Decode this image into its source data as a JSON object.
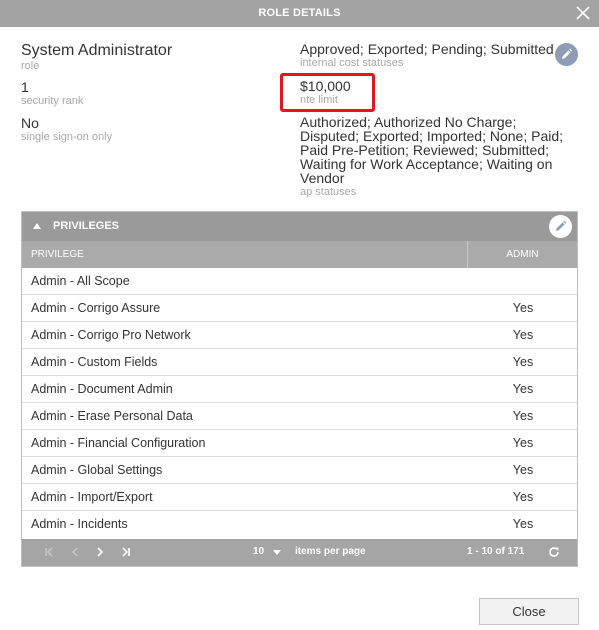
{
  "dialog": {
    "title": "ROLE DETAILS",
    "close_label": "Close"
  },
  "details": {
    "role": {
      "value": "System Administrator",
      "label": "role"
    },
    "security_rank": {
      "value": "1",
      "label": "security rank"
    },
    "sso": {
      "value": "No",
      "label": "single sign-on only"
    },
    "internal_cost_statuses": {
      "value": "Approved; Exported; Pending; Submitted",
      "label": "internal cost statuses"
    },
    "nte_limit": {
      "value": "$10,000",
      "label": "nte limit"
    },
    "ap_statuses": {
      "lines": [
        "Authorized; Authorized No Charge;",
        "Disputed; Exported; Imported; None; Paid;",
        "Paid Pre-Petition; Reviewed; Submitted;",
        "Waiting for Work Acceptance; Waiting on",
        "Vendor"
      ],
      "label": "ap statuses"
    }
  },
  "privileges": {
    "title": "PRIVILEGES",
    "columns": {
      "privilege": "PRIVILEGE",
      "admin": "ADMIN"
    },
    "rows": [
      {
        "privilege": "Admin - All Scope",
        "admin": ""
      },
      {
        "privilege": "Admin - Corrigo Assure",
        "admin": "Yes"
      },
      {
        "privilege": "Admin - Corrigo Pro Network",
        "admin": "Yes"
      },
      {
        "privilege": "Admin - Custom Fields",
        "admin": "Yes"
      },
      {
        "privilege": "Admin - Document Admin",
        "admin": "Yes"
      },
      {
        "privilege": "Admin - Erase Personal Data",
        "admin": "Yes"
      },
      {
        "privilege": "Admin - Financial Configuration",
        "admin": "Yes"
      },
      {
        "privilege": "Admin - Global Settings",
        "admin": "Yes"
      },
      {
        "privilege": "Admin - Import/Export",
        "admin": "Yes"
      },
      {
        "privilege": "Admin - Incidents",
        "admin": "Yes"
      }
    ],
    "pager": {
      "page_size": "10",
      "items_per_page": "items per page",
      "range": "1 - 10 of 171"
    }
  },
  "colors": {
    "titlebar": "#a3a3a3",
    "panel_header": "#9a9a9a",
    "highlight": "#e0181e",
    "edit_icon": "#8c9db5"
  },
  "icons": {
    "close": "close-icon",
    "edit": "pencil-icon",
    "collapse": "triangle-up-icon",
    "first": "first-page-icon",
    "prev": "prev-page-icon",
    "next": "next-page-icon",
    "last": "last-page-icon",
    "refresh": "refresh-icon"
  }
}
